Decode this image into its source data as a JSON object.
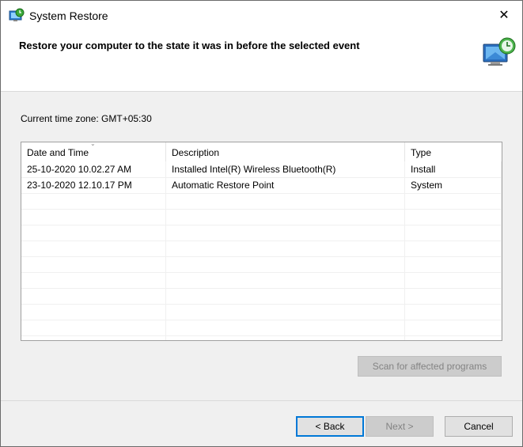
{
  "window": {
    "title": "System Restore",
    "close_glyph": "✕"
  },
  "header": {
    "heading": "Restore your computer to the state it was in before the selected event"
  },
  "timezone_label": "Current time zone: GMT+05:30",
  "list": {
    "sort_indicator": "⌄",
    "columns": [
      "Date and Time",
      "Description",
      "Type"
    ],
    "rows": [
      {
        "date_time": "25-10-2020 10.02.27 AM",
        "description": "Installed Intel(R) Wireless Bluetooth(R)",
        "type": "Install"
      },
      {
        "date_time": "23-10-2020 12.10.17 PM",
        "description": "Automatic Restore Point",
        "type": "System"
      }
    ]
  },
  "buttons": {
    "scan": "Scan for affected programs",
    "back": "< Back",
    "next": "Next >",
    "cancel": "Cancel"
  },
  "icons": {
    "title_icon": "system-restore-icon",
    "header_icon": "system-restore-monitor-icon",
    "close_icon": "close-icon"
  },
  "colors": {
    "accent": "#0078d7",
    "window_bg": "#f0f0f0"
  }
}
